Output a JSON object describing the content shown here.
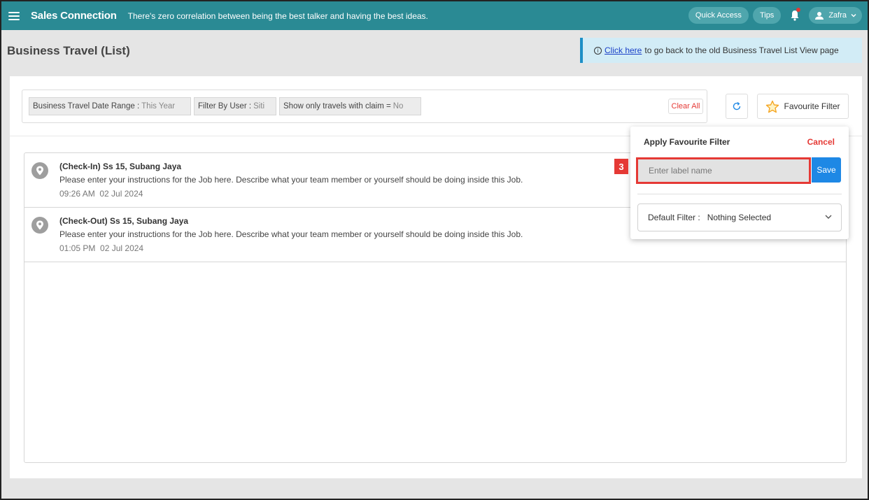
{
  "topbar": {
    "brand": "Sales Connection",
    "tagline": "There's zero correlation between being the best talker and having the best ideas.",
    "quick_access": "Quick Access",
    "tips": "Tips",
    "user_name": "Zafra"
  },
  "header": {
    "title": "Business Travel (List)",
    "banner": {
      "icon_text": "i",
      "link_text": "Click here",
      "rest_text": "to go back to the old Business Travel List View page"
    }
  },
  "filters": {
    "chips": [
      {
        "label": "Business Travel Date Range",
        "sep": ":",
        "value": "This Year"
      },
      {
        "label": "Filter By User",
        "sep": ":",
        "value": "Siti"
      },
      {
        "label": "Show only travels with claim",
        "sep": "=",
        "value": "No"
      }
    ],
    "clear_all": "Clear All",
    "favourite_filter": "Favourite Filter"
  },
  "list": {
    "items": [
      {
        "title": "(Check-In) Ss 15, Subang Jaya",
        "description": "Please enter your instructions for the Job here. Describe what your team member or yourself should be doing inside this Job.",
        "time": "09:26 AM",
        "date": "02 Jul 2024"
      },
      {
        "title": "(Check-Out) Ss 15, Subang Jaya",
        "description": "Please enter your instructions for the Job here. Describe what your team member or yourself should be doing inside this Job.",
        "time": "01:05 PM",
        "date": "02 Jul 2024"
      }
    ]
  },
  "popup": {
    "title": "Apply Favourite Filter",
    "cancel": "Cancel",
    "label_placeholder": "Enter label name",
    "label_value": "",
    "save": "Save",
    "default_filter_label": "Default Filter :",
    "default_filter_value": "Nothing Selected",
    "step_number": "3"
  },
  "colors": {
    "topbar": "#2a8a94",
    "accent_red": "#e53935",
    "save_blue": "#1e88e5",
    "banner_bg": "#d2ecf6"
  },
  "icons": [
    "menu-icon",
    "bell-icon",
    "user-icon",
    "chevron-down-icon",
    "info-icon",
    "refresh-icon",
    "star-icon",
    "location-pin-icon"
  ]
}
